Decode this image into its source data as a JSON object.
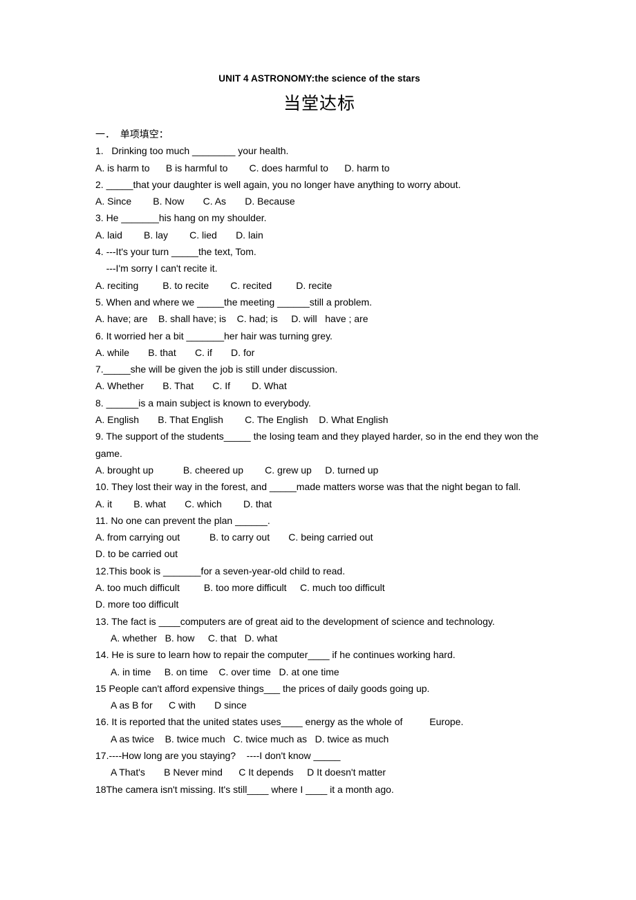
{
  "document": {
    "title": "UNIT 4 ASTRONOMY:the science of the stars",
    "chinese_heading": "当堂达标",
    "section_heading": "一．  单项填空："
  },
  "questions": [
    {
      "id": "q1",
      "stem": "1.   Drinking too much ________ your health.",
      "options": "A. is harm to      B is harmful to        C. does harmful to      D. harm to"
    },
    {
      "id": "q2",
      "stem": "2. _____that your daughter is well again, you no longer have anything to worry about.",
      "options": "A. Since        B. Now       C. As       D. Because"
    },
    {
      "id": "q3",
      "stem": "3. He _______his hang on my shoulder.",
      "options": "A. laid        B. lay        C. lied       D. lain"
    },
    {
      "id": "q4",
      "stem": "4. ---It's your turn _____the text, Tom.",
      "stem2": "    ---I'm sorry I can't recite it.",
      "options": "A. reciting         B. to recite        C. recited         D. recite"
    },
    {
      "id": "q5",
      "stem": "5. When and where we _____the meeting ______still a problem.",
      "options": "A. have; are    B. shall have; is    C. had; is     D. will   have ; are"
    },
    {
      "id": "q6",
      "stem": "6. It worried her a bit _______her hair was turning grey.",
      "options": "A. while       B. that       C. if       D. for"
    },
    {
      "id": "q7",
      "stem": "7._____she will be given the job is still under discussion.",
      "options": "A. Whether       B. That       C. If        D. What"
    },
    {
      "id": "q8",
      "stem": "8. ______is a main subject is known to everybody.",
      "options": "A. English       B. That English        C. The English    D. What English"
    },
    {
      "id": "q9",
      "stem": "9. The support of the students_____ the losing team and they played harder, so in the end they won the game.",
      "options": "A. brought up           B. cheered up        C. grew up     D. turned up"
    },
    {
      "id": "q10",
      "stem": "10. They lost their way in the forest, and _____made matters worse was that the night began to fall.",
      "options": "A. it        B. what       C. which        D. that"
    },
    {
      "id": "q11",
      "stem": "11. No one can prevent the plan ______.",
      "options": "A. from carrying out           B. to carry out       C. being carried out",
      "options2": "D. to be carried out"
    },
    {
      "id": "q12",
      "stem": "12.This book is _______for a seven-year-old child to read.",
      "options": "A. too much difficult         B. too more difficult     C. much too difficult",
      "options2": "D. more too difficult"
    },
    {
      "id": "q13",
      "stem": "13. The fact is ____computers are of great aid to the development of science and technology.",
      "options": "A. whether   B. how     C. that   D. what"
    },
    {
      "id": "q14",
      "stem": "14. He is sure to learn how to repair the computer____ if he continues working hard.",
      "options": "A. in time     B. on time    C. over time   D. at one time"
    },
    {
      "id": "q15",
      "stem": "15 People can't afford expensive things___ the prices of daily goods going up.",
      "options": "A as B for      C with       D since"
    },
    {
      "id": "q16",
      "stem": "16. It is reported that the united states uses____ energy as the whole of          Europe.",
      "options": "A as twice    B. twice much   C. twice much as   D. twice as much"
    },
    {
      "id": "q17",
      "stem": "17.----How long are you staying?    ----I don't know _____",
      "options": "A That's       B Never mind      C It depends     D It doesn't matter"
    },
    {
      "id": "q18",
      "stem": "18The camera isn't missing. It's still____ where I ____ it a month ago.",
      "options": ""
    }
  ]
}
